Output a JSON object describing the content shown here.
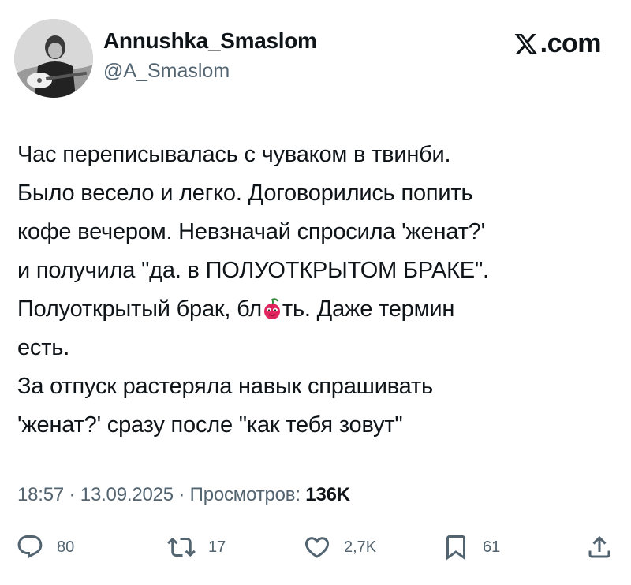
{
  "author": {
    "display_name": "Annushka_Smaslom",
    "handle": "@A_Smaslom"
  },
  "brand": {
    "label": ".com",
    "icon": "x-logo-icon"
  },
  "tweet": {
    "lines": [
      "Час переписывалась с чуваком в твинби.",
      "Было весело и легко. Договорились попить",
      "кофе вечером. Невзначай спросила 'женат?'",
      "и получила \"да. в ПОЛУОТКРЫТОМ БРАКЕ\".",
      "Полуоткрытый брак, бл",
      "ть. Даже термин",
      "есть.",
      "За отпуск растеряла навык спрашивать",
      "'женат?' сразу после \"как тебя зовут\""
    ],
    "inline_emoji": "cherry-face-emoji"
  },
  "meta": {
    "time": "18:57",
    "date": "13.09.2025",
    "views_label": "Просмотров:",
    "views_count": "136K"
  },
  "actions": {
    "replies": "80",
    "reposts": "17",
    "likes": "2,7K",
    "bookmarks": "61",
    "icons": [
      "reply-icon",
      "repost-icon",
      "like-icon",
      "bookmark-icon",
      "share-icon"
    ]
  },
  "colors": {
    "text": "#0f1419",
    "secondary": "#536471",
    "background": "#ffffff"
  }
}
